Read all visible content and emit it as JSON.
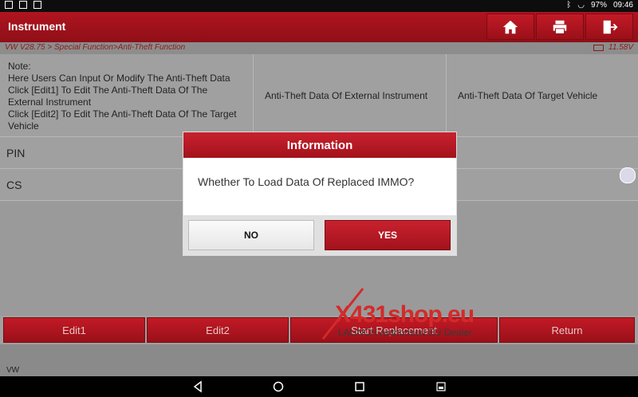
{
  "statusbar": {
    "battery": "97%",
    "time": "09:46"
  },
  "header": {
    "title": "Instrument"
  },
  "breadcrumb": {
    "path": "VW V28.75 > Special Function>Anti-Theft Function",
    "voltage": "11.58V"
  },
  "table": {
    "note_lines": [
      "Note:",
      "Here Users Can Input Or Modify The Anti-Theft Data",
      "Click [Edit1] To Edit The Anti-Theft Data Of The External Instrument",
      "Click [Edit2] To Edit The Anti-Theft Data Of The Target Vehicle"
    ],
    "col2_header": "Anti-Theft Data Of External Instrument",
    "col3_header": "Anti-Theft Data Of Target Vehicle",
    "rows": [
      {
        "label": "PIN"
      },
      {
        "label": "CS"
      }
    ]
  },
  "buttons": {
    "edit1": "Edit1",
    "edit2": "Edit2",
    "start": "Start Replacement",
    "return": "Return"
  },
  "footer": {
    "brand": "VW"
  },
  "dialog": {
    "title": "Information",
    "message": "Whether To Load Data Of Replaced IMMO?",
    "no_label": "NO",
    "yes_label": "YES"
  },
  "watermark": {
    "text": "X431shop.eu",
    "subtext": "LAUNCH Authorized EU Dealer"
  },
  "colors": {
    "brand_red": "#b0141f",
    "background": "#9a9a9a"
  }
}
